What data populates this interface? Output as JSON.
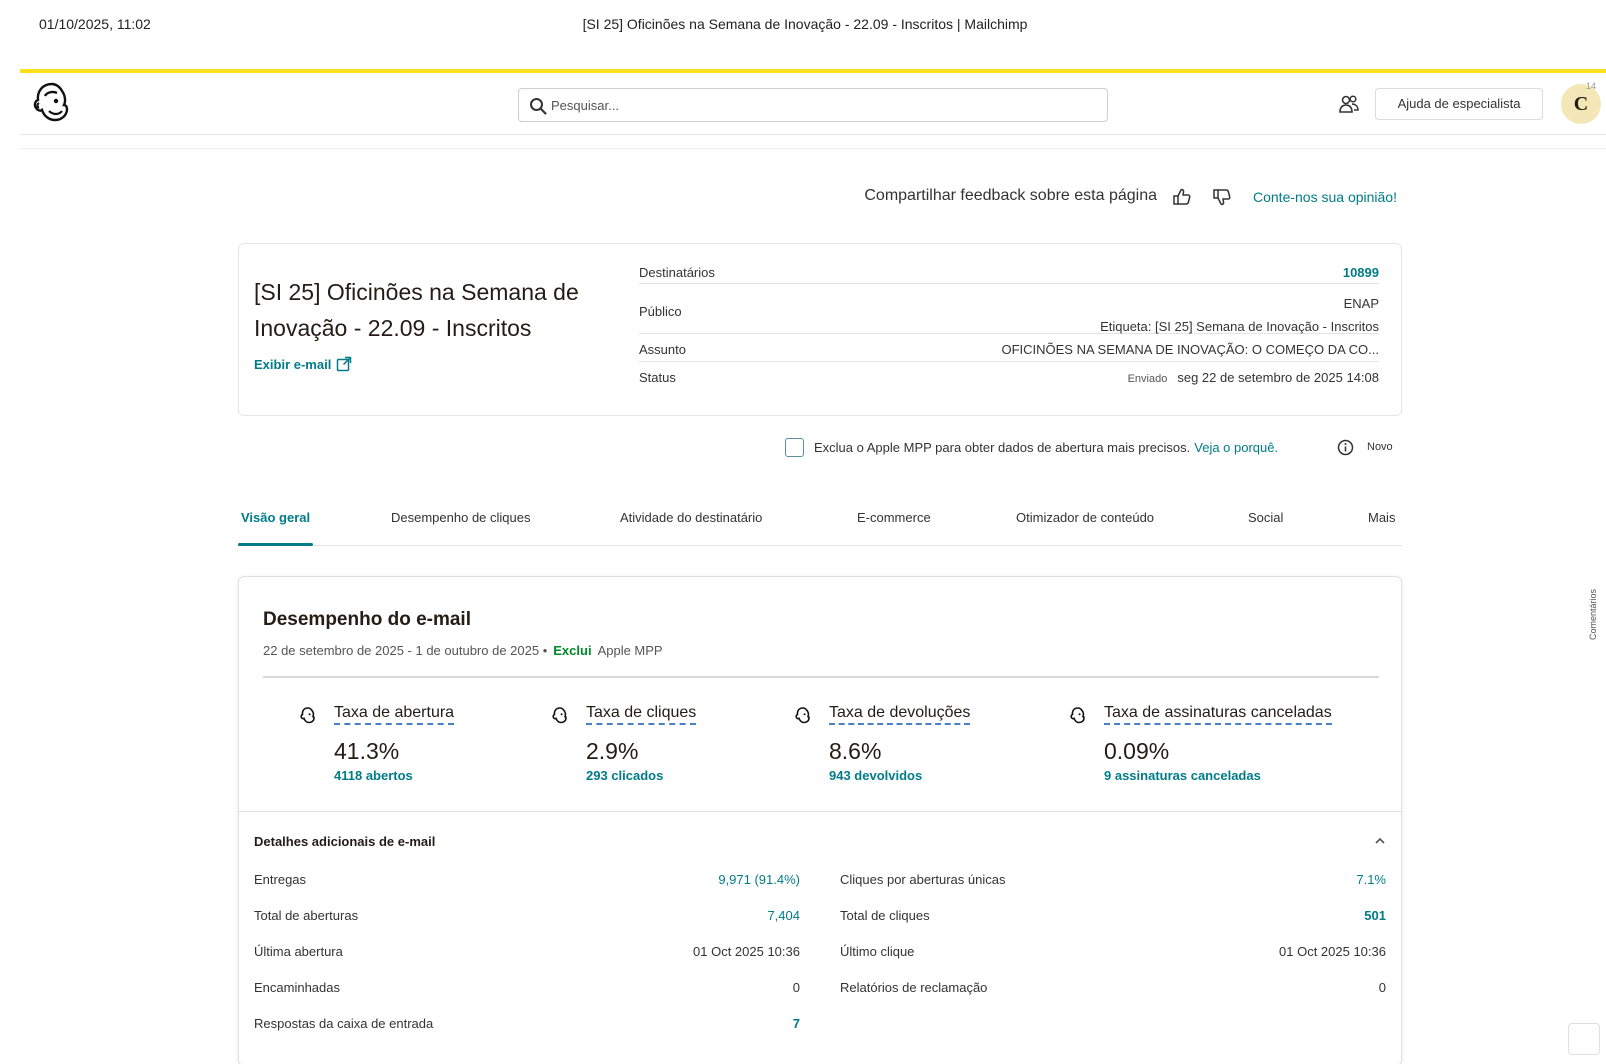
{
  "print_header": {
    "datetime": "01/10/2025, 11:02",
    "title": "[SI 25] Oficinões na Semana de Inovação - 22.09 - Inscritos | Mailchimp"
  },
  "topbar": {
    "search_placeholder": "Pesquisar...",
    "help_label": "Ajuda de especialista",
    "avatar_letter": "C",
    "avatar_count": "14"
  },
  "feedback": {
    "text": "Compartilhar feedback sobre esta página",
    "link": "Conte-nos sua opinião!"
  },
  "campaign": {
    "title": "[SI 25] Oficinões na Semana de Inovação - 22.09 - Inscritos",
    "view_email": "Exibir e-mail",
    "recipients_label": "Destinatários",
    "recipients_value": "10899",
    "audience_label": "Público",
    "audience_name": "ENAP",
    "audience_tag": "Etiqueta: [SI 25] Semana de Inovação - Inscritos",
    "subject_label": "Assunto",
    "subject_value": "OFICINÕES NA SEMANA DE INOVAÇÃO: O COMEÇO DA CO...",
    "status_label": "Status",
    "status_sent": "Enviado",
    "status_value": "seg 22 de setembro de 2025 14:08"
  },
  "mpp": {
    "text": "Exclua o Apple MPP para obter dados de abertura mais precisos.",
    "link": "Veja o porquê.",
    "badge": "Novo"
  },
  "tabs": [
    "Visão geral",
    "Desempenho de cliques",
    "Atividade do destinatário",
    "E-commerce",
    "Otimizador de conteúdo",
    "Social",
    "Mais"
  ],
  "performance": {
    "title": "Desempenho do e-mail",
    "date_range": "22 de setembro de 2025 - 1 de outubro de 2025 •",
    "exclui": "Exclui",
    "apple_mpp": "Apple MPP",
    "metrics": [
      {
        "label": "Taxa de abertura",
        "value": "41.3%",
        "link": "4118 abertos"
      },
      {
        "label": "Taxa de cliques",
        "value": "2.9%",
        "link": "293 clicados"
      },
      {
        "label": "Taxa de devoluções",
        "value": "8.6%",
        "link": "943 devolvidos"
      },
      {
        "label": "Taxa de assinaturas canceladas",
        "value": "0.09%",
        "link": "9 assinaturas canceladas"
      }
    ]
  },
  "additional": {
    "title": "Detalhes adicionais de e-mail",
    "left": [
      {
        "label": "Entregas",
        "value": "9,971 (91.4%)"
      },
      {
        "label": "Total de aberturas",
        "value": "7,404"
      },
      {
        "label": "Última abertura",
        "value": "01 Oct 2025 10:36"
      },
      {
        "label": "Encaminhadas",
        "value": "0"
      },
      {
        "label": "Respostas da caixa de entrada",
        "value": "7"
      }
    ],
    "right": [
      {
        "label": "Cliques por aberturas únicas",
        "value": "7.1%"
      },
      {
        "label": "Total de cliques",
        "value": "501"
      },
      {
        "label": "Último clique",
        "value": "01 Oct 2025 10:36"
      },
      {
        "label": "Relatórios de reclamação",
        "value": "0"
      }
    ]
  },
  "side_tab": "Comentários",
  "colors": {
    "accent": "#007c89",
    "brand_yellow": "#ffe01b",
    "exclude_green": "#00892b"
  }
}
